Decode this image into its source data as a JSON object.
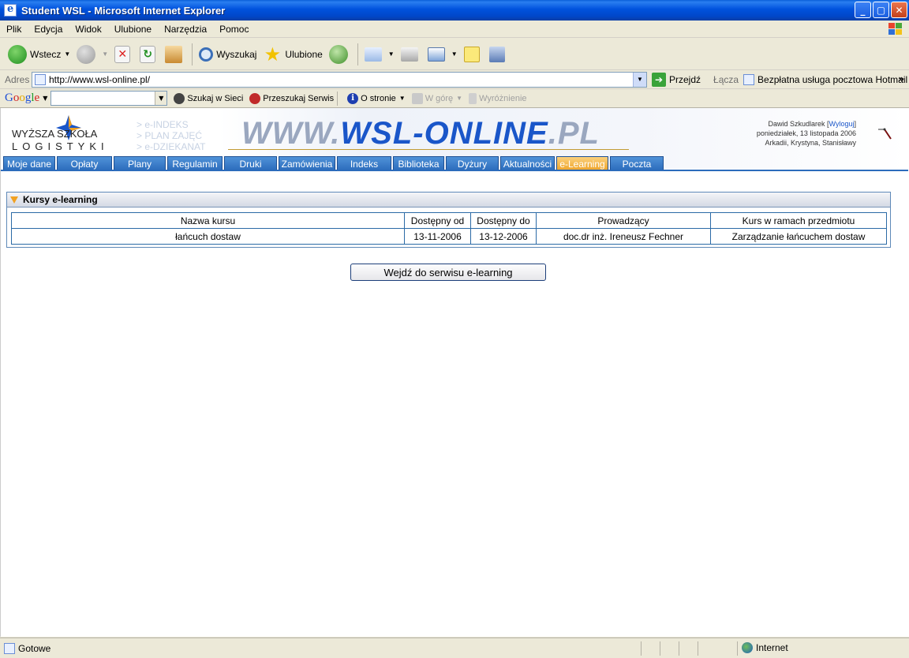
{
  "window": {
    "title": "Student WSL - Microsoft Internet Explorer",
    "min": "_",
    "max": "▢",
    "close": "✕"
  },
  "menu": [
    "Plik",
    "Edycja",
    "Widok",
    "Ulubione",
    "Narzędzia",
    "Pomoc"
  ],
  "toolbar": {
    "back": "Wstecz",
    "search": "Wyszukaj",
    "favorites": "Ulubione"
  },
  "address": {
    "label": "Adres",
    "url": "http://www.wsl-online.pl/",
    "go": "Przejdź",
    "links": "Łącza",
    "hotmail": "Bezpłatna usługa pocztowa Hotmail"
  },
  "google": {
    "search_web": "Szukaj w Sieci",
    "search_site": "Przeszukaj Serwis",
    "about": "O stronie",
    "up": "W górę",
    "highlight": "Wyróżnienie"
  },
  "site": {
    "logo_line1": "WYŻSZA SZKOŁA",
    "logo_line2": "LOGISTYKI",
    "side_links": [
      "> e-INDEKS",
      "> PLAN ZAJĘĆ",
      "> e-DZIEKANAT"
    ],
    "title_a": "WWW.",
    "title_b": "WSL-ONLINE",
    "title_c": ".PL",
    "user": "Dawid Szkudlarek",
    "logout": "Wyloguj",
    "date": "poniedziałek, 13 listopada 2006",
    "names": "Arkadii, Krystyna, Stanisławy",
    "tabs": [
      "Moje dane",
      "Opłaty",
      "Plany",
      "Regulamin",
      "Druki",
      "Zamówienia",
      "Indeks",
      "Biblioteka",
      "Dyżury",
      "Aktualności",
      "e-Learning",
      "Poczta"
    ],
    "active_tab": "e-Learning"
  },
  "panel": {
    "title": "Kursy e-learning",
    "columns": [
      "Nazwa kursu",
      "Dostępny od",
      "Dostępny do",
      "Prowadzący",
      "Kurs w ramach przedmiotu"
    ],
    "rows": [
      [
        "łańcuch dostaw",
        "13-11-2006",
        "13-12-2006",
        "doc.dr inż. Ireneusz Fechner",
        "Zarządzanie łańcuchem dostaw"
      ]
    ]
  },
  "enter_button": "Wejdź do serwisu e-learning",
  "status": {
    "text": "Gotowe",
    "zone": "Internet"
  }
}
